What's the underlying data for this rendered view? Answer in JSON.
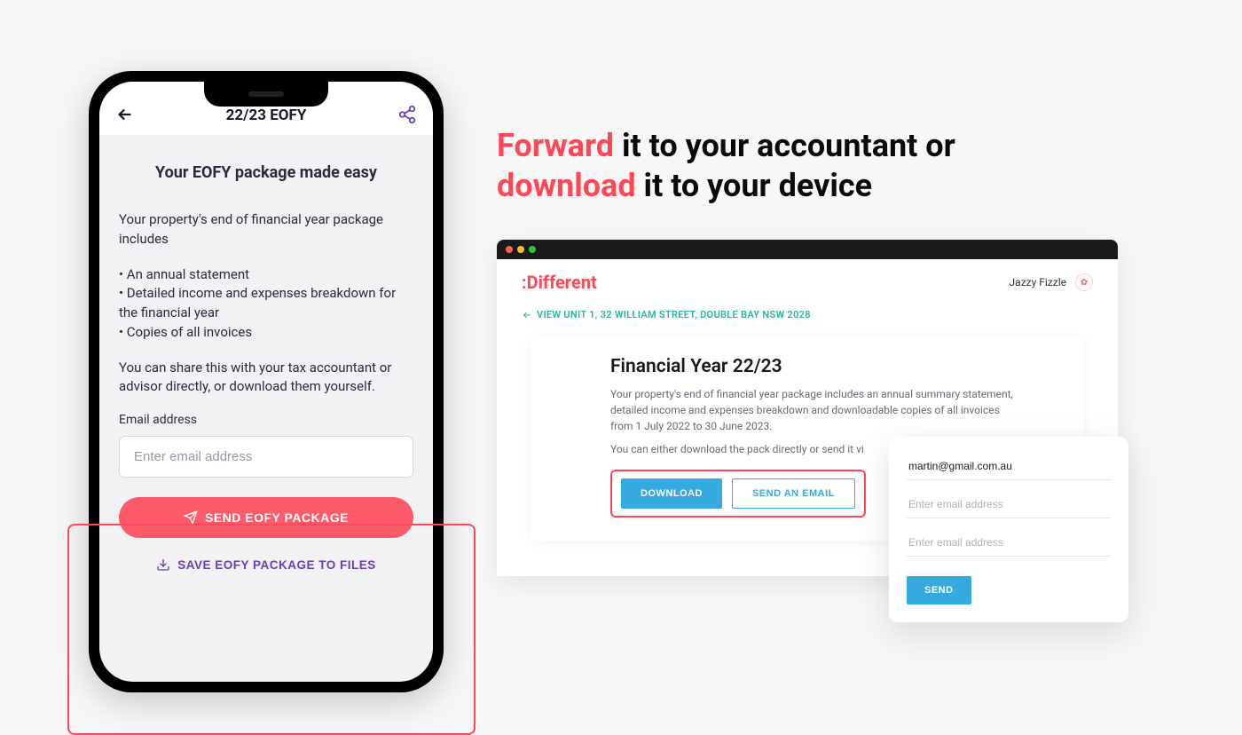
{
  "phone": {
    "title": "22/23 EOFY",
    "heading": "Your EOFY package made easy",
    "intro": "Your property's end of financial year package includes",
    "bullet1": "• An annual statement",
    "bullet2": "• Detailed income and expenses breakdown for the financial year",
    "bullet3": "• Copies of all invoices",
    "share_text": "You can share this with your tax accountant or advisor directly, or download them yourself.",
    "email_label": "Email address",
    "email_placeholder": "Enter email address",
    "send_label": "SEND EOFY PACKAGE",
    "save_label": "SAVE EOFY PACKAGE TO FILES"
  },
  "marketing": {
    "w1": "Forward",
    "w2": " it to your accountant or ",
    "w3": "download",
    "w4": " it to your device"
  },
  "web": {
    "logo": ":Different",
    "user": "Jazzy Fizzle",
    "breadcrumb": "VIEW UNIT 1, 32 WILLIAM STREET, DOUBLE BAY NSW 2028",
    "fy_title": "Financial Year 22/23",
    "fy_desc": "Your property's end of financial year package includes an annual summary statement, detailed income and expenses breakdown and downloadable copies of all invoices from 1 July 2022 to 30 June 2023.",
    "fy_desc2": "You can either download the pack directly or send it vi",
    "download": "DOWNLOAD",
    "send_email": "SEND AN EMAIL"
  },
  "popover": {
    "prefilled": "martin@gmail.com.au",
    "placeholder": "Enter email address",
    "send": "SEND"
  }
}
